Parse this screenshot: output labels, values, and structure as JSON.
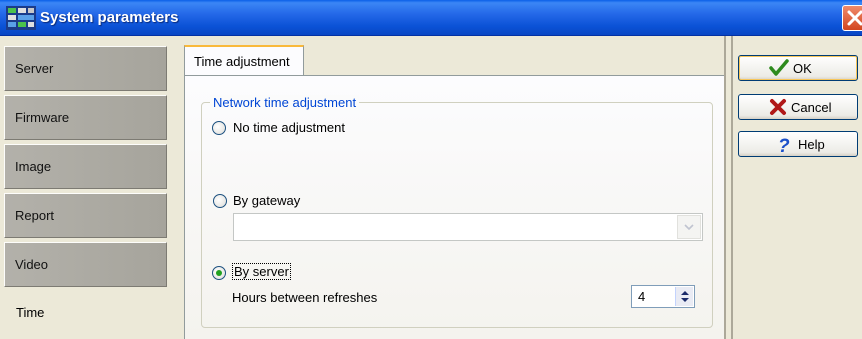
{
  "window": {
    "title": "System parameters",
    "app_icon": "system-grid-icon",
    "close_icon": "close-x-icon"
  },
  "sidebar": {
    "items": [
      {
        "label": "Server",
        "active": false
      },
      {
        "label": "Firmware",
        "active": false
      },
      {
        "label": "Image",
        "active": false
      },
      {
        "label": "Report",
        "active": false
      },
      {
        "label": "Video",
        "active": false
      },
      {
        "label": "Time",
        "active": true
      }
    ]
  },
  "tabs": [
    {
      "label": "Time adjustment",
      "selected": true
    }
  ],
  "group": {
    "title": "Network time adjustment",
    "options": [
      {
        "label": "No time adjustment",
        "checked": false
      },
      {
        "label": "By gateway",
        "checked": false
      },
      {
        "label": "By server",
        "checked": true
      }
    ],
    "gateway_combo": {
      "value": ""
    },
    "refresh": {
      "label": "Hours between refreshes",
      "value": "4"
    }
  },
  "buttons": {
    "ok": {
      "label": "OK",
      "icon": "checkmark-icon",
      "color": "#2e8b1e"
    },
    "cancel": {
      "label": "Cancel",
      "icon": "x-icon",
      "color": "#b01818"
    },
    "help": {
      "label": "Help",
      "icon": "question-icon",
      "color": "#1a4fc9"
    }
  }
}
